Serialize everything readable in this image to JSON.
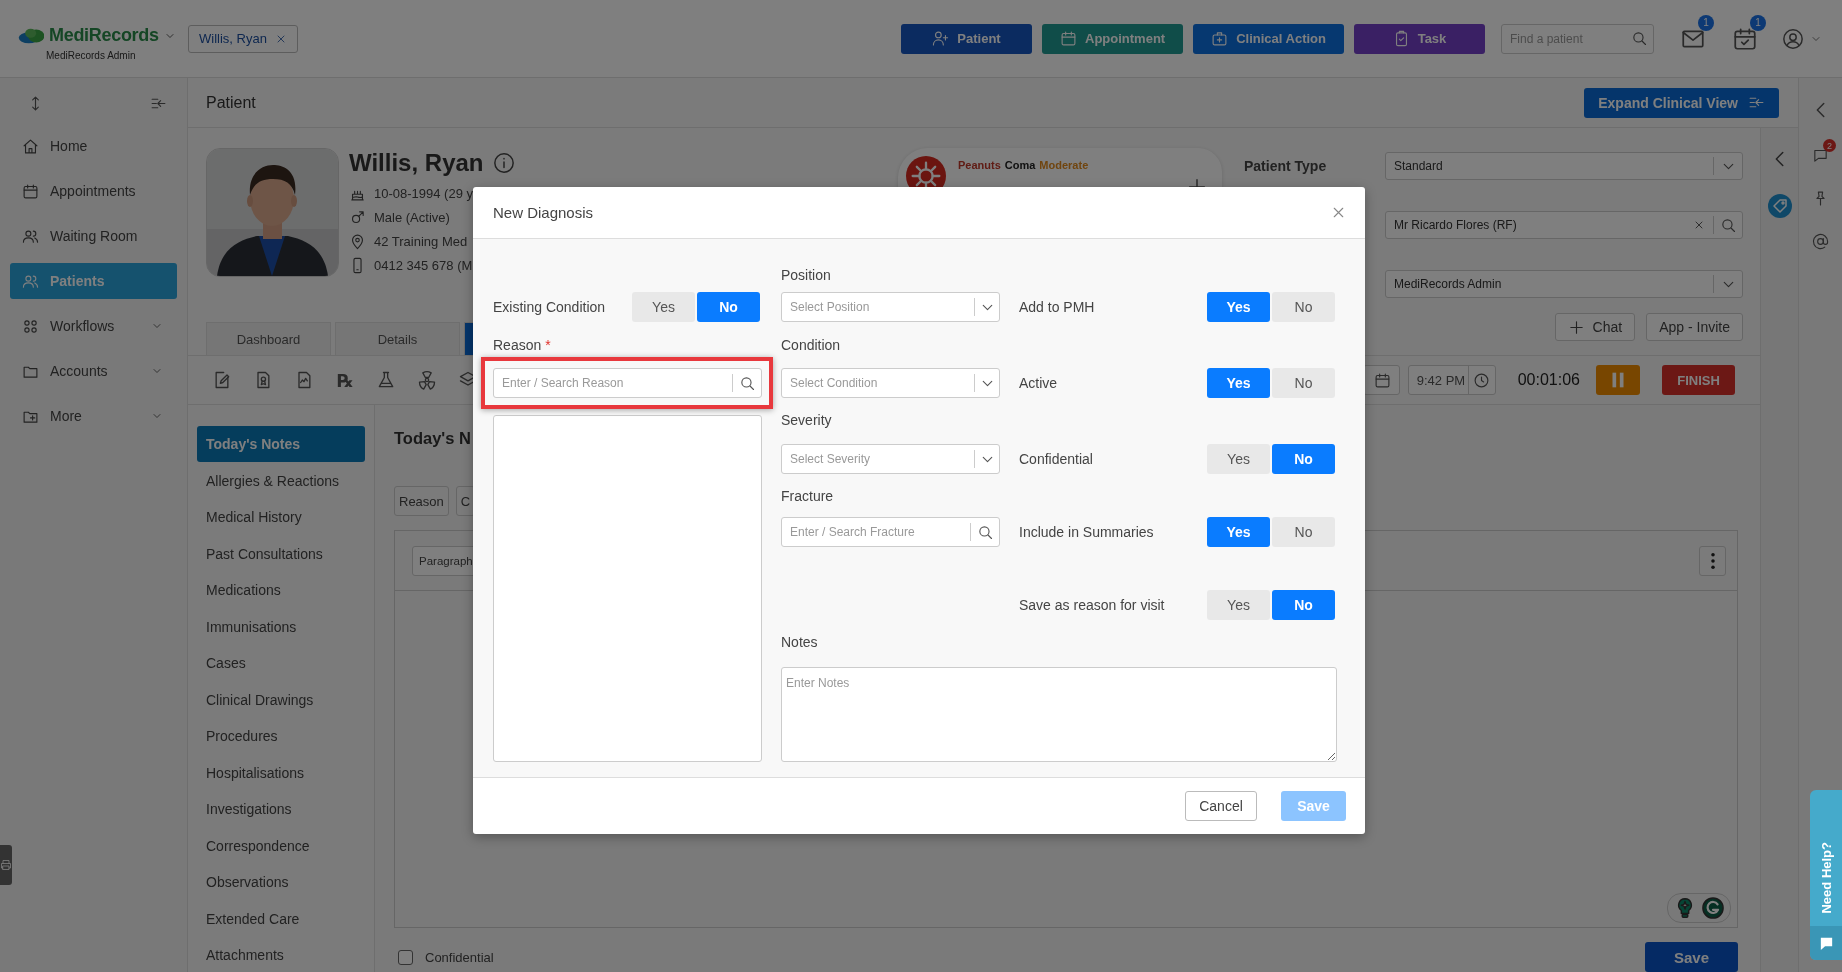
{
  "app": {
    "brand": "MediRecords",
    "brand_caption": "MediRecords Admin"
  },
  "open_patient": {
    "label": "Willis, Ryan"
  },
  "quick_actions": [
    {
      "label": "Patient",
      "color": "#0b2b60"
    },
    {
      "label": "Appointment",
      "color": "#104d49"
    },
    {
      "label": "Clinical Action",
      "color": "#063870"
    },
    {
      "label": "Task",
      "color": "#3a2064"
    }
  ],
  "patient_search": {
    "placeholder": "Find a patient"
  },
  "notifications": [
    {
      "count": "1"
    },
    {
      "count": "1"
    }
  ],
  "sidebar": {
    "items": [
      {
        "label": "Home",
        "selected": false,
        "expandable": false
      },
      {
        "label": "Appointments",
        "selected": false,
        "expandable": false
      },
      {
        "label": "Waiting Room",
        "selected": false,
        "expandable": false
      },
      {
        "label": "Patients",
        "selected": true,
        "expandable": false
      },
      {
        "label": "Workflows",
        "selected": false,
        "expandable": true
      },
      {
        "label": "Accounts",
        "selected": false,
        "expandable": true
      },
      {
        "label": "More",
        "selected": false,
        "expandable": true
      }
    ]
  },
  "page_header": {
    "title": "Patient",
    "action": "Expand Clinical View"
  },
  "patient": {
    "name": "Willis, Ryan",
    "details": [
      "10-08-1994 (29 y",
      "Male (Active)",
      "42 Training Med",
      "0412 345 678 (M"
    ]
  },
  "allergy": {
    "allergen": "Peanuts",
    "reaction": "Coma",
    "severity": "Moderate"
  },
  "patient_settings": {
    "rows": [
      {
        "kind": "select",
        "label": "Patient Type",
        "value": "Standard"
      },
      {
        "kind": "search",
        "value": "Mr Ricardo Flores (RF)"
      },
      {
        "kind": "select",
        "value": "MediRecords Admin"
      }
    ],
    "buttons": [
      {
        "kind": "add",
        "label": "Chat"
      },
      {
        "kind": "plain",
        "label": "App - Invite"
      }
    ]
  },
  "patient_tabs": [
    {
      "label": "Dashboard",
      "selected": false
    },
    {
      "label": "Details",
      "selected": false
    },
    {
      "selected": true
    }
  ],
  "clinical_toolbar": {
    "rx_symbol": "℞"
  },
  "consultation": {
    "time": "9:42 PM",
    "timer": "00:01:06",
    "finish": "FINISH"
  },
  "notes_menu": [
    {
      "label": "Today's Notes",
      "selected": true
    },
    {
      "label": "Allergies & Reactions",
      "selected": false
    },
    {
      "label": "Medical History",
      "selected": false
    },
    {
      "label": "Past Consultations",
      "selected": false
    },
    {
      "label": "Medications",
      "selected": false
    },
    {
      "label": "Immunisations",
      "selected": false
    },
    {
      "label": "Cases",
      "selected": false
    },
    {
      "label": "Clinical Drawings",
      "selected": false
    },
    {
      "label": "Procedures",
      "selected": false
    },
    {
      "label": "Hospitalisations",
      "selected": false
    },
    {
      "label": "Investigations",
      "selected": false
    },
    {
      "label": "Correspondence",
      "selected": false
    },
    {
      "label": "Observations",
      "selected": false
    },
    {
      "label": "Extended Care",
      "selected": false
    },
    {
      "label": "Attachments",
      "selected": false
    }
  ],
  "notes": {
    "title": "Today's N",
    "chips": [
      "Reason",
      "C"
    ],
    "format": "Paragraph",
    "confidential": {
      "label": "Confidential",
      "checked": false
    },
    "save": "Save"
  },
  "right_rail": {
    "chat_badge": "2"
  },
  "help_tab": {
    "label": "Need Help?"
  },
  "dialog": {
    "title": "New Diagnosis",
    "existing_condition": {
      "label": "Existing Condition",
      "options": [
        {
          "label": "Yes",
          "selected": false
        },
        {
          "label": "No",
          "selected": true
        }
      ]
    },
    "reason": {
      "label": "Reason",
      "required_mark": "*",
      "placeholder": "Enter / Search Reason",
      "highlighted": true
    },
    "position": {
      "label": "Position",
      "placeholder": "Select Position"
    },
    "condition": {
      "label": "Condition",
      "placeholder": "Select Condition"
    },
    "severity": {
      "label": "Severity",
      "placeholder": "Select Severity"
    },
    "fracture": {
      "label": "Fracture",
      "placeholder": "Enter / Search Fracture"
    },
    "flags": [
      {
        "label": "Add to PMH",
        "options": [
          {
            "label": "Yes",
            "selected": true
          },
          {
            "label": "No",
            "selected": false
          }
        ]
      },
      {
        "label": "Active",
        "options": [
          {
            "label": "Yes",
            "selected": true
          },
          {
            "label": "No",
            "selected": false
          }
        ]
      },
      {
        "label": "Confidential",
        "options": [
          {
            "label": "Yes",
            "selected": false
          },
          {
            "label": "No",
            "selected": true
          }
        ]
      },
      {
        "label": "Include in Summaries",
        "options": [
          {
            "label": "Yes",
            "selected": true
          },
          {
            "label": "No",
            "selected": false
          }
        ]
      },
      {
        "label": "Save as reason for visit",
        "options": [
          {
            "label": "Yes",
            "selected": false
          },
          {
            "label": "No",
            "selected": true
          }
        ]
      }
    ],
    "notes": {
      "label": "Notes",
      "placeholder": "Enter Notes"
    },
    "cancel": "Cancel",
    "save": {
      "label": "Save",
      "disabled": true
    }
  }
}
